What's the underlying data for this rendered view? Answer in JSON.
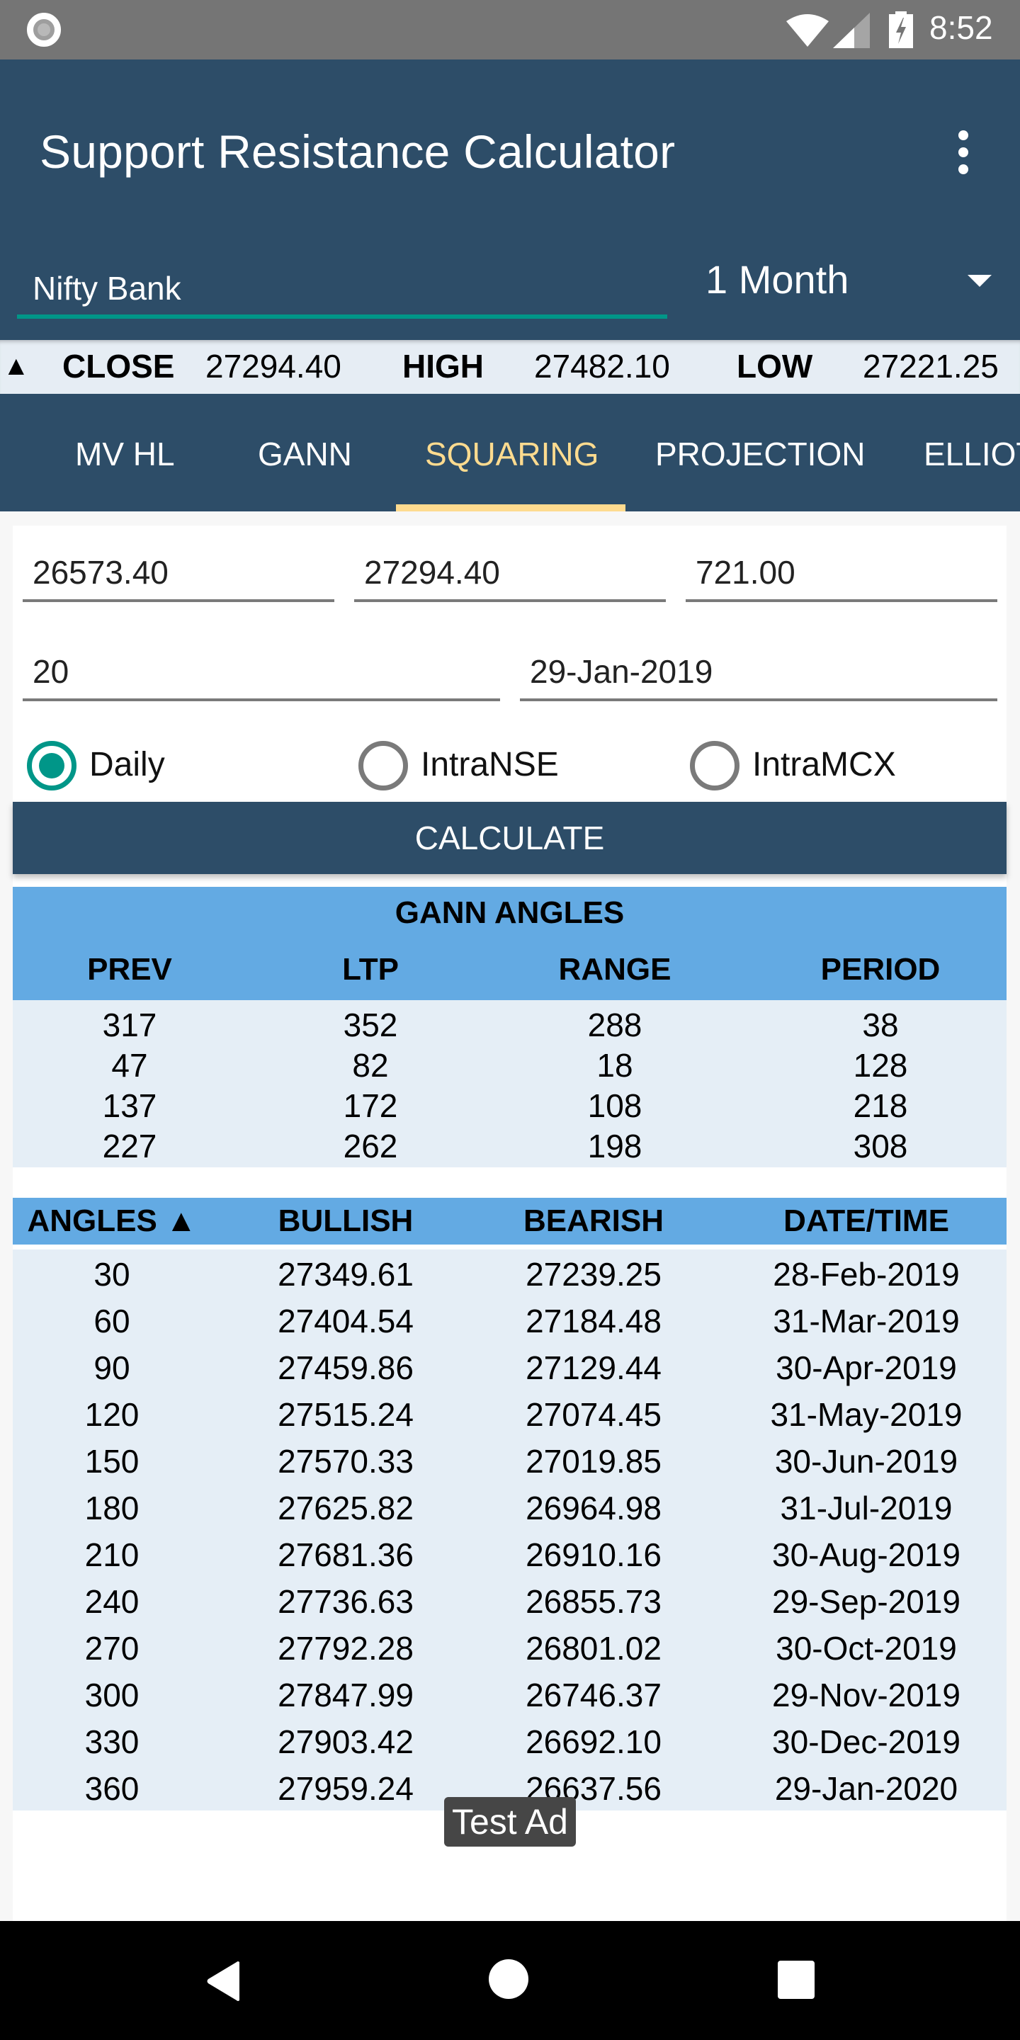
{
  "status_bar": {
    "time": "8:52",
    "icons": [
      "notification-circle-icon",
      "wifi-icon",
      "cell-signal-icon",
      "battery-charging-icon"
    ]
  },
  "app_bar": {
    "title": "Support Resistance Calculator",
    "menu_icon": "overflow-menu-icon",
    "symbol_input": {
      "value": "Nifty Bank",
      "placeholder": ""
    },
    "period_select": {
      "selected": "1 Month"
    }
  },
  "ticker": {
    "arrow": "▲",
    "close_label": "CLOSE",
    "close_value": "27294.40",
    "high_label": "HIGH",
    "high_value": "27482.10",
    "low_label": "LOW",
    "low_value": "27221.25"
  },
  "tabs": [
    {
      "label": "MV HL",
      "active": false
    },
    {
      "label": "GANN",
      "active": false
    },
    {
      "label": "SQUARING",
      "active": true
    },
    {
      "label": "PROJECTION",
      "active": false
    },
    {
      "label": "ELLIOTT",
      "active": false
    }
  ],
  "form": {
    "field1": "26573.40",
    "field2": "27294.40",
    "field3": "721.00",
    "field4": "20",
    "date": "29-Jan-2019",
    "radios": [
      {
        "label": "Daily",
        "checked": true
      },
      {
        "label": "IntraNSE",
        "checked": false
      },
      {
        "label": "IntraMCX",
        "checked": false
      }
    ],
    "calculate_label": "CALCULATE"
  },
  "gann_table": {
    "title": "GANN ANGLES",
    "headers": [
      "PREV",
      "LTP",
      "RANGE",
      "PERIOD"
    ],
    "rows": [
      [
        "317",
        "352",
        "288",
        "38"
      ],
      [
        "47",
        "82",
        "18",
        "128"
      ],
      [
        "137",
        "172",
        "108",
        "218"
      ],
      [
        "227",
        "262",
        "198",
        "308"
      ]
    ]
  },
  "angles_table": {
    "headers": [
      "ANGLES ▲",
      "BULLISH",
      "BEARISH",
      "DATE/TIME"
    ],
    "rows": [
      [
        "30",
        "27349.61",
        "27239.25",
        "28-Feb-2019"
      ],
      [
        "60",
        "27404.54",
        "27184.48",
        "31-Mar-2019"
      ],
      [
        "90",
        "27459.86",
        "27129.44",
        "30-Apr-2019"
      ],
      [
        "120",
        "27515.24",
        "27074.45",
        "31-May-2019"
      ],
      [
        "150",
        "27570.33",
        "27019.85",
        "30-Jun-2019"
      ],
      [
        "180",
        "27625.82",
        "26964.98",
        "31-Jul-2019"
      ],
      [
        "210",
        "27681.36",
        "26910.16",
        "30-Aug-2019"
      ],
      [
        "240",
        "27736.63",
        "26855.73",
        "29-Sep-2019"
      ],
      [
        "270",
        "27792.28",
        "26801.02",
        "30-Oct-2019"
      ],
      [
        "300",
        "27847.99",
        "26746.37",
        "29-Nov-2019"
      ],
      [
        "330",
        "27903.42",
        "26692.10",
        "30-Dec-2019"
      ],
      [
        "360",
        "27959.24",
        "26637.56",
        "29-Jan-2020"
      ]
    ]
  },
  "ad": {
    "label": "Test Ad"
  },
  "colors": {
    "primary": "#2d4d68",
    "accent_tab": "#fedb8f",
    "teal": "#009688",
    "table_header": "#63aae3",
    "table_row": "#e5eef6"
  }
}
